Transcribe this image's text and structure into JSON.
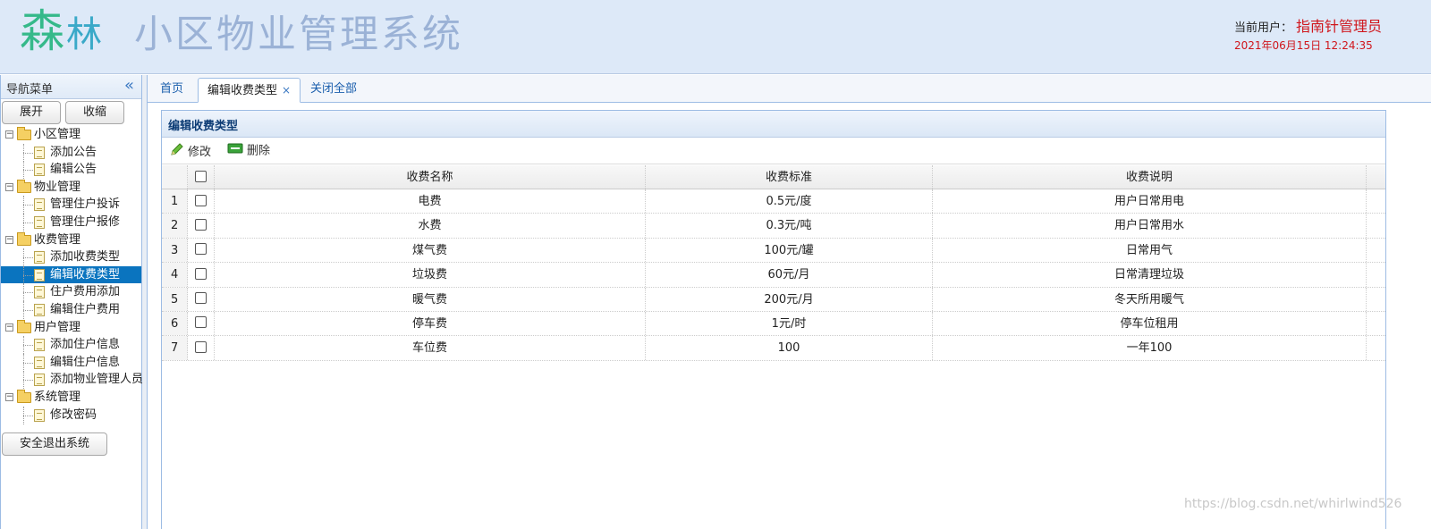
{
  "header": {
    "logo_sen": "森",
    "logo_lin": "林",
    "title": "小区物业管理系统",
    "user_label": "当前用户：",
    "user_name": "指南针管理员",
    "datetime": "2021年06月15日 12:24:35"
  },
  "sidebar": {
    "title": "导航菜单",
    "collapse_icon": "«",
    "expand_button": "展开",
    "collapse_button": "收缩",
    "logout_button": "安全退出系统",
    "groups": [
      {
        "label": "小区管理",
        "items": [
          "添加公告",
          "编辑公告"
        ]
      },
      {
        "label": "物业管理",
        "items": [
          "管理住户投诉",
          "管理住户报修"
        ]
      },
      {
        "label": "收费管理",
        "items": [
          "添加收费类型",
          "编辑收费类型",
          "住户费用添加",
          "编辑住户费用"
        ]
      },
      {
        "label": "用户管理",
        "items": [
          "添加住户信息",
          "编辑住户信息",
          "添加物业管理人员"
        ]
      },
      {
        "label": "系统管理",
        "items": [
          "修改密码"
        ]
      }
    ],
    "selected_item": "编辑收费类型"
  },
  "tabs": {
    "home": "首页",
    "active": "编辑收费类型",
    "close_icon": "×",
    "close_all": "关闭全部"
  },
  "panel": {
    "title": "编辑收费类型",
    "edit_button": "修改",
    "delete_button": "删除"
  },
  "table": {
    "columns": [
      "收费名称",
      "收费标准",
      "收费说明"
    ],
    "rows": [
      {
        "num": "1",
        "name": "电费",
        "standard": "0.5元/度",
        "desc": "用户日常用电"
      },
      {
        "num": "2",
        "name": "水费",
        "standard": "0.3元/吨",
        "desc": "用户日常用水"
      },
      {
        "num": "3",
        "name": "煤气费",
        "standard": "100元/罐",
        "desc": "日常用气"
      },
      {
        "num": "4",
        "name": "垃圾费",
        "standard": "60元/月",
        "desc": "日常清理垃圾"
      },
      {
        "num": "5",
        "name": "暖气费",
        "standard": "200元/月",
        "desc": "冬天所用暖气"
      },
      {
        "num": "6",
        "name": "停车费",
        "standard": "1元/时",
        "desc": "停车位租用"
      },
      {
        "num": "7",
        "name": "车位费",
        "standard": "100",
        "desc": "一年100"
      }
    ]
  },
  "watermark": "https://blog.csdn.net/whirlwind526",
  "colors": {
    "header_bg": "#dde9f8",
    "accent": "#0a74bf",
    "user_red": "#d0161c"
  }
}
